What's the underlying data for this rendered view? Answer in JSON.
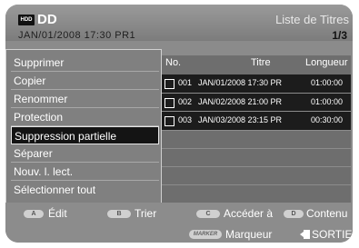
{
  "header": {
    "hdd_icon": "HDD",
    "device": "DD",
    "date_line": "JAN/01/2008 17:30 PR1",
    "screen_title": "Liste de Titres",
    "page": "1/3"
  },
  "list": {
    "columns": [
      "No.",
      "Titre",
      "Longueur"
    ],
    "rows": [
      {
        "no": "001",
        "title": "JAN/01/2008 17:30 PR",
        "length": "01:00:00"
      },
      {
        "no": "002",
        "title": "JAN/02/2008 21:00 PR",
        "length": "01:00:00"
      },
      {
        "no": "003",
        "title": "JAN/03/2008 23:15 PR",
        "length": "00:30:00"
      }
    ]
  },
  "menu": {
    "items": [
      "Supprimer",
      "Copier",
      "Renommer",
      "Protection",
      "Suppression partielle",
      "Séparer",
      "Nouv. l. lect.",
      "Sélectionner tout"
    ],
    "active_index": 4
  },
  "footer": {
    "a_key": "A",
    "a_label": "Édit",
    "b_key": "B",
    "b_label": "Trier",
    "c_key": "C",
    "c_label": "Accéder à",
    "d_key": "D",
    "d_label": "Contenu",
    "marker_key": "MARKER",
    "marker_label": "Marqueur",
    "exit_label": "SORTIE"
  },
  "colors": {
    "background": "#8b8b8b",
    "selection": "#141414",
    "text": "#ffffff"
  }
}
